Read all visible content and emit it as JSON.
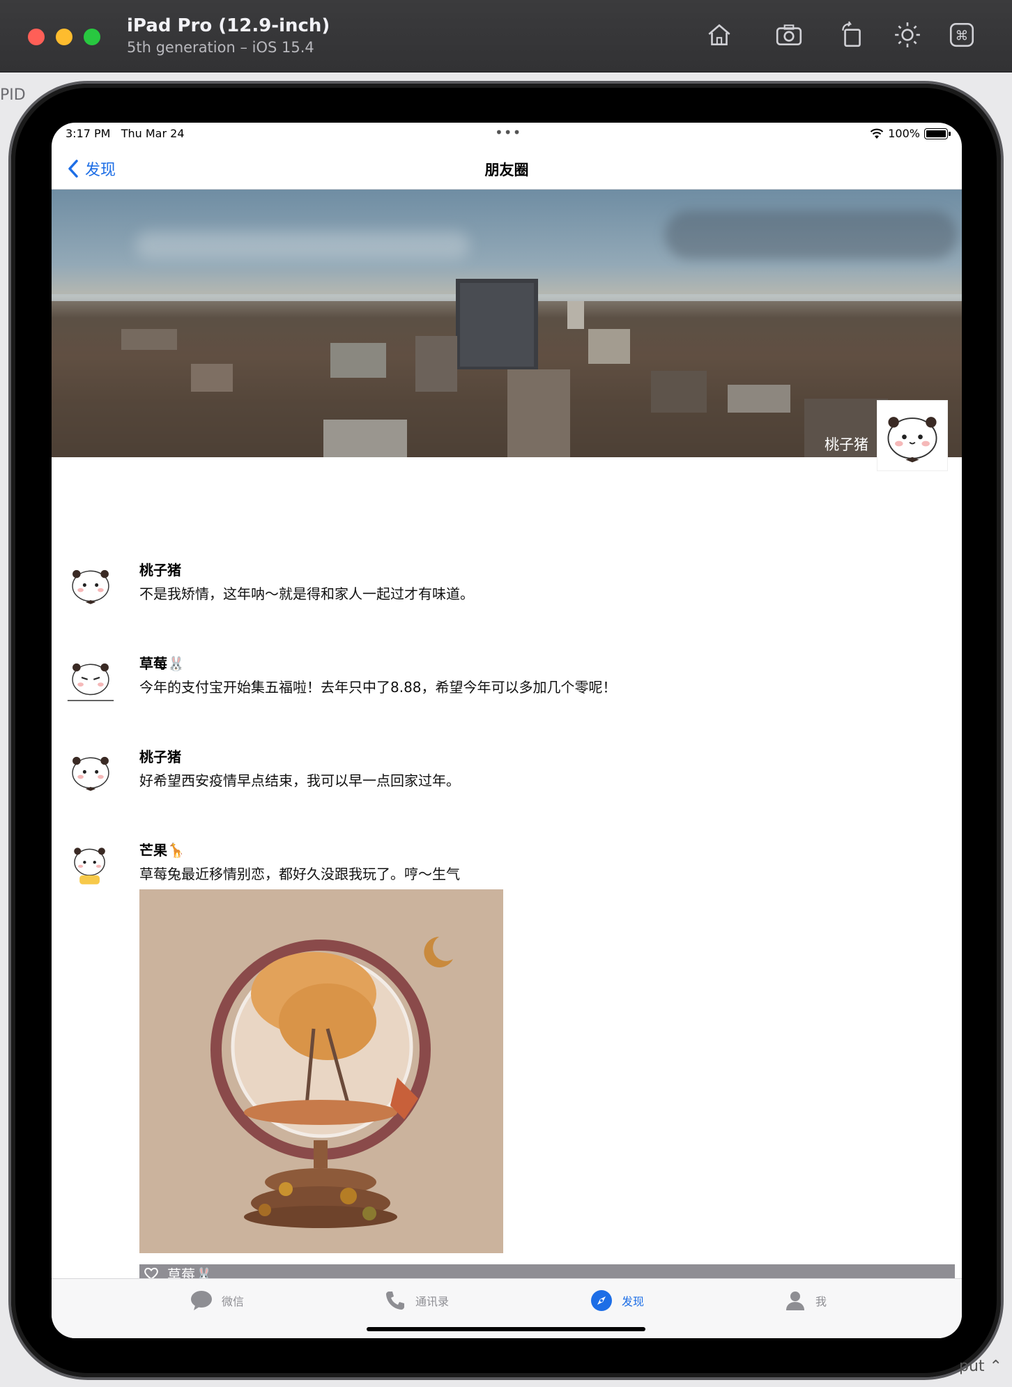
{
  "simulator": {
    "title": "iPad Pro (12.9-inch)",
    "subtitle": "5th generation – iOS 15.4",
    "toolbar_icons": [
      "home-icon",
      "screenshot-icon",
      "rotate-icon",
      "appearance-icon",
      "command-icon"
    ]
  },
  "backdrop": {
    "left_label": "PID"
  },
  "status_bar": {
    "time_date": "3:17 PM   Thu Mar 24",
    "dots": "•••",
    "battery_text": "100%",
    "battery_level": 1.0
  },
  "nav": {
    "back_label": "发现",
    "title": "朋友圈"
  },
  "cover": {
    "user_name": "桃子猪"
  },
  "posts": [
    {
      "name": "桃子猪",
      "text": "不是我矫情，这年呐～就是得和家人一起过才有味道。"
    },
    {
      "name": "草莓🐰",
      "text": "今年的支付宝开始集五福啦！去年只中了8.88，希望今年可以多加几个零呢！"
    },
    {
      "name": "桃子猪",
      "text": "好希望西安疫情早点结束，我可以早一点回家过年。"
    },
    {
      "name": "芒果🦒",
      "text": "草莓兔最近移情别恋，都好久没跟我玩了。哼～生气",
      "likes": "草莓🐰"
    }
  ],
  "tabs": [
    {
      "label": "微信",
      "icon": "chat-bubble-icon"
    },
    {
      "label": "通讯录",
      "icon": "phone-icon"
    },
    {
      "label": "发现",
      "icon": "compass-icon",
      "active": true
    },
    {
      "label": "我",
      "icon": "person-icon"
    }
  ],
  "side_fragments": {
    "bottom_right": "put ⌃"
  },
  "colors": {
    "accent": "#1d6ee6",
    "like_bar": "#8f8e94"
  }
}
